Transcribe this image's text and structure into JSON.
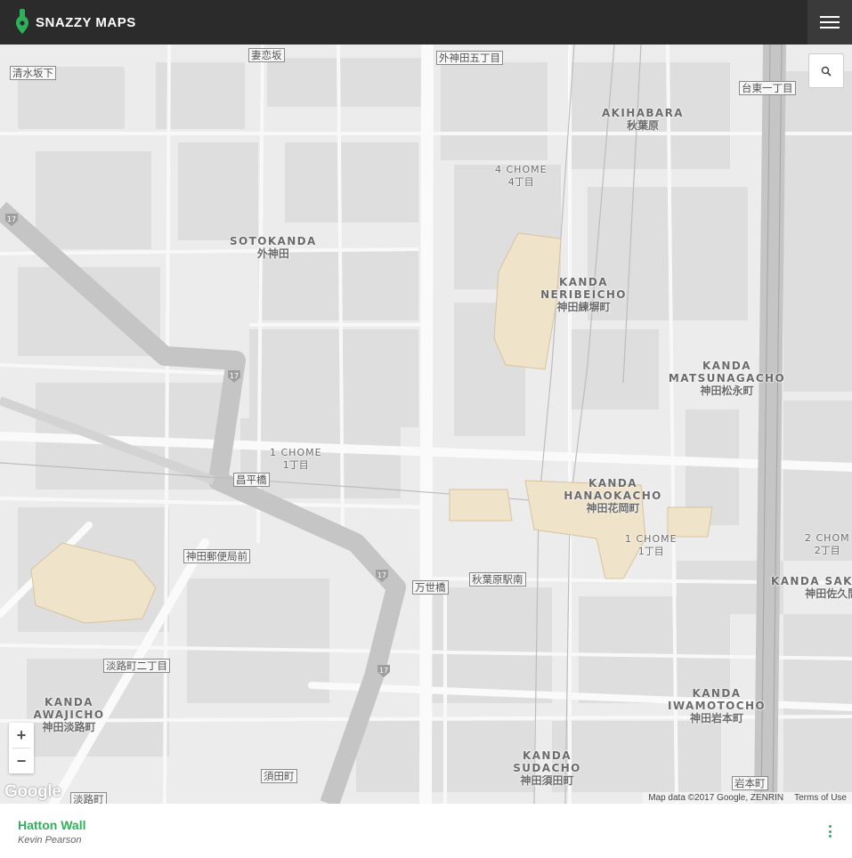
{
  "app": {
    "brand": "SNAZZY MAPS",
    "accent": "#2eb15a",
    "topbar_bg": "#2b2b2b",
    "menu_icon": "hamburger-icon",
    "search_icon": "search-icon"
  },
  "map": {
    "areas": [
      {
        "en": "AKIHABARA",
        "ja": "秋葉原"
      },
      {
        "en": "4 CHOME",
        "ja": "4丁目"
      },
      {
        "en": "SOTOKANDA",
        "ja": "外神田"
      },
      {
        "en": "KANDA NERIBEICHO",
        "ja": "神田練塀町"
      },
      {
        "en": "KANDA MATSUNAGACHO",
        "ja": "神田松永町"
      },
      {
        "en": "1 CHOME",
        "ja": "1丁目"
      },
      {
        "en": "KANDA HANAOKACHO",
        "ja": "神田花岡町"
      },
      {
        "en": "1 CHOME",
        "ja": "1丁目"
      },
      {
        "en": "2 CHOM",
        "ja": "2丁目"
      },
      {
        "en": "KANDA SAKUMACH",
        "ja": "神田佐久間町"
      },
      {
        "en": "KANDA IWAMOTOCHO",
        "ja": "神田岩本町"
      },
      {
        "en": "KANDA AWAJICHO",
        "ja": "神田淡路町"
      },
      {
        "en": "KANDA SUDACHO",
        "ja": "神田須田町"
      }
    ],
    "stations": [
      "清水坂下",
      "妻恋坂",
      "外神田五丁目",
      "台東一丁目",
      "昌平橋",
      "神田郵便局前",
      "万世橋",
      "秋葉原駅南",
      "淡路町二丁目",
      "須田町",
      "岩本町",
      "淡路町"
    ],
    "route_shields": [
      "17",
      "17",
      "17",
      "17"
    ],
    "zoom": {
      "in": "+",
      "out": "−"
    },
    "google_logo": "Google",
    "attribution": "Map data ©2017 Google, ZENRIN",
    "terms": "Terms of Use",
    "colors": {
      "land": "#ececec",
      "block": "#dcdcdc",
      "road": "#fafafa",
      "highway": "#c2c2c2",
      "rail": "#b8b8b8",
      "building": "#efe2c6"
    }
  },
  "footer": {
    "style_name": "Hatton Wall",
    "author": "Kevin Pearson"
  }
}
